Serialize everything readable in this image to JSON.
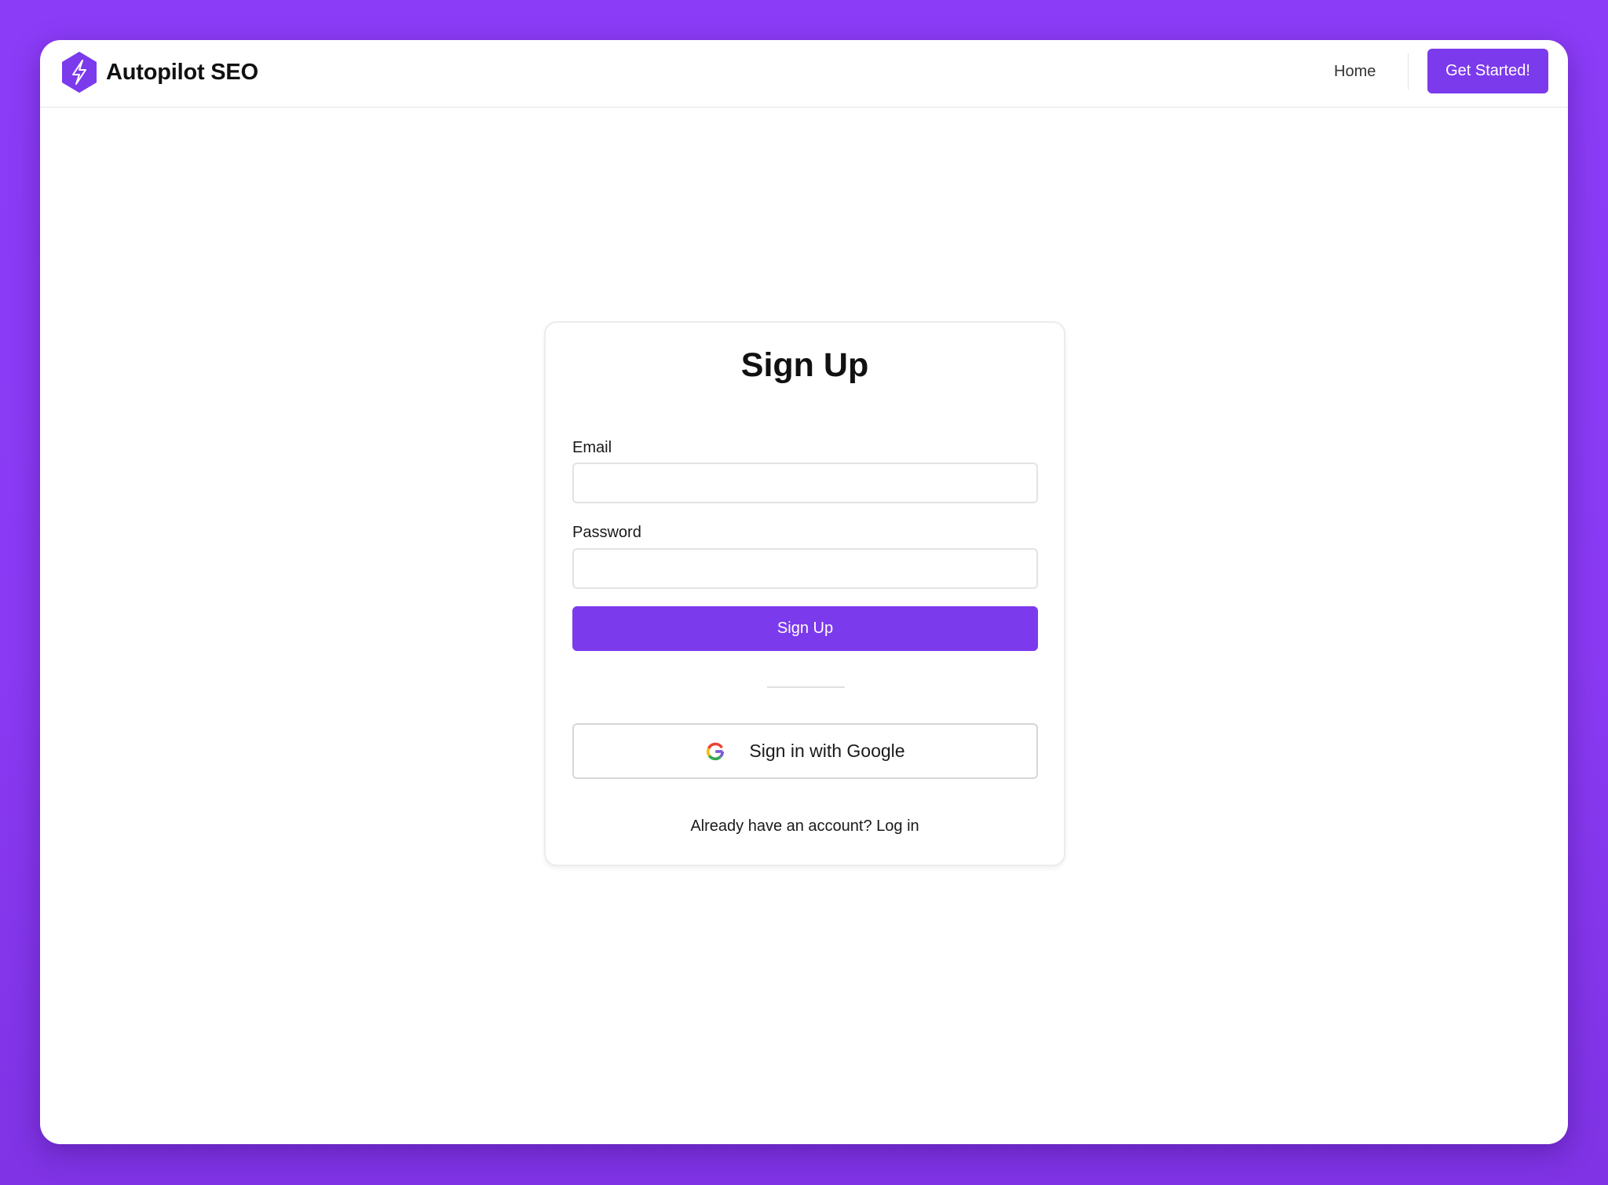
{
  "navbar": {
    "brand_name": "Autopilot SEO",
    "home_label": "Home",
    "cta_label": "Get Started!"
  },
  "signup": {
    "title": "Sign Up",
    "email_label": "Email",
    "email_value": "",
    "password_label": "Password",
    "password_value": "",
    "submit_label": "Sign Up",
    "google_label": "Sign in with Google",
    "footer_prompt": "Already have an account?",
    "footer_link": "Log in"
  },
  "icons": {
    "brand_logo": "hexagon-lightning-icon",
    "google_logo": "google-g-icon"
  },
  "colors": {
    "background": "#8b3cf7",
    "accent": "#7c3aed",
    "window": "#ffffff"
  }
}
